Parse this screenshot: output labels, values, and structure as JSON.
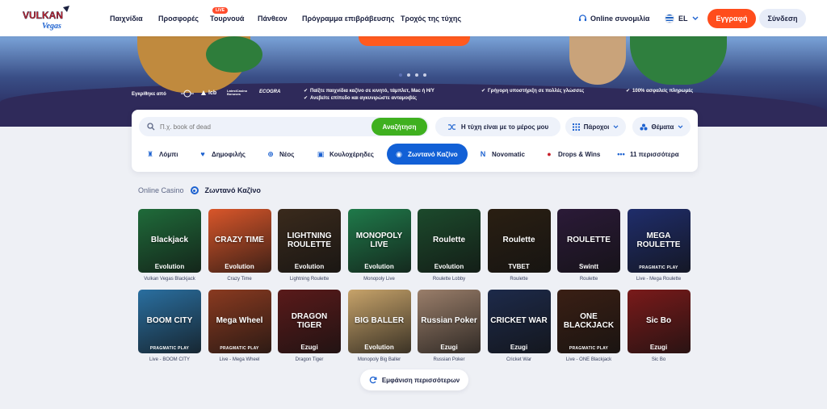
{
  "header": {
    "logo_text": "VULKAN Vegas",
    "nav": [
      "Παιχνίδια",
      "Προσφορές",
      "Τουρνουά",
      "Πάνθεον",
      "Πρόγραμμα επιβράβευσης",
      "Τροχός της τύχης"
    ],
    "live_badge": "LIVE",
    "chat": "Online συνομιλία",
    "lang": "EL",
    "register": "Εγγραφή",
    "login": "Σύνδεση"
  },
  "hero": {
    "approved_by": "Εγκρίθηκε από",
    "licenses": [
      "lcb",
      "LatestCasino Bonuses",
      "ECOGRA"
    ],
    "features": [
      "Παίξτε παιχνίδια καζίνο σε κινητό, τάμπλετ, Mac ή Η/Υ",
      "Ανεβείτε επίπεδο και αγκυνιρώστε ανταμοιβές",
      "Γρήγορη υποστήριξη σε πολλές γλώσσες",
      "100% ασφαλείς πληρωμές"
    ]
  },
  "search": {
    "placeholder": "Π.χ. book of dead",
    "button": "Αναζήτηση",
    "luck": "Η τύχη είναι με το μέρος μου",
    "providers": "Πάροχοι",
    "topics": "Θέματα"
  },
  "categories": [
    {
      "label": "Λόμπι",
      "icon": "lobby-icon"
    },
    {
      "label": "Δημοφιλής",
      "icon": "heart-icon"
    },
    {
      "label": "Νέος",
      "icon": "plus-icon"
    },
    {
      "label": "Κουλοχέρηδες",
      "icon": "slot-icon"
    },
    {
      "label": "Ζωντανό Καζίνο",
      "icon": "live-icon",
      "active": true
    },
    {
      "label": "Novomatic",
      "icon": "novomatic-icon"
    },
    {
      "label": "Drops & Wins",
      "icon": "drops-icon"
    },
    {
      "label": "11 περισσότερα",
      "icon": "more-icon"
    }
  ],
  "breadcrumb": {
    "root": "Online Casino",
    "current": "Ζωντανό Καζίνο"
  },
  "games": [
    {
      "name": "Vulkan Vegas Blackjack",
      "title": "Blackjack",
      "provider": "Evolution",
      "color": "#1f6b3a"
    },
    {
      "name": "Crazy Time",
      "title": "CRAZY TIME",
      "provider": "Evolution",
      "color": "#d9562a"
    },
    {
      "name": "Lightning Roulette",
      "title": "LIGHTNING ROULETTE",
      "provider": "Evolution",
      "color": "#3a2a1c"
    },
    {
      "name": "Monopoly Live",
      "title": "MONOPOLY LIVE",
      "provider": "Evolution",
      "color": "#1f7a4a"
    },
    {
      "name": "Roulette Lobby",
      "title": "Roulette",
      "provider": "Evolution",
      "color": "#1c4a2c"
    },
    {
      "name": "Roulette",
      "title": "Roulette",
      "provider": "TVBET",
      "color": "#2a1f12"
    },
    {
      "name": "Roulette",
      "title": "ROULETTE",
      "provider": "Swintt",
      "color": "#2b1a38"
    },
    {
      "name": "Live - Mega Roulette",
      "title": "MEGA ROULETTE",
      "provider": "PRAGMATIC PLAY",
      "color": "#1f2d6b"
    },
    {
      "name": "Live - BOOM CITY",
      "title": "BOOM CITY",
      "provider": "PRAGMATIC PLAY",
      "color": "#2a6fa0"
    },
    {
      "name": "Live - Mega Wheel",
      "title": "Mega Wheel",
      "provider": "PRAGMATIC PLAY",
      "color": "#8a3a20"
    },
    {
      "name": "Dragon Tiger",
      "title": "DRAGON TIGER",
      "provider": "Ezugi",
      "color": "#5a1a1a"
    },
    {
      "name": "Monopoly Big Baller",
      "title": "BIG BALLER",
      "provider": "Evolution",
      "color": "#c7a36a"
    },
    {
      "name": "Russian Poker",
      "title": "Russian Poker",
      "provider": "Ezugi",
      "color": "#9a7e6a"
    },
    {
      "name": "Cricket War",
      "title": "CRICKET WAR",
      "provider": "Ezugi",
      "color": "#1d2a4a"
    },
    {
      "name": "Live - ONE Blackjack",
      "title": "ONE BLACKJACK",
      "provider": "PRAGMATIC PLAY",
      "color": "#3a1f14"
    },
    {
      "name": "Sic Bo",
      "title": "Sic Bo",
      "provider": "Ezugi",
      "color": "#7a1a1a"
    }
  ],
  "show_more": "Εμφάνιση περισσότερων"
}
